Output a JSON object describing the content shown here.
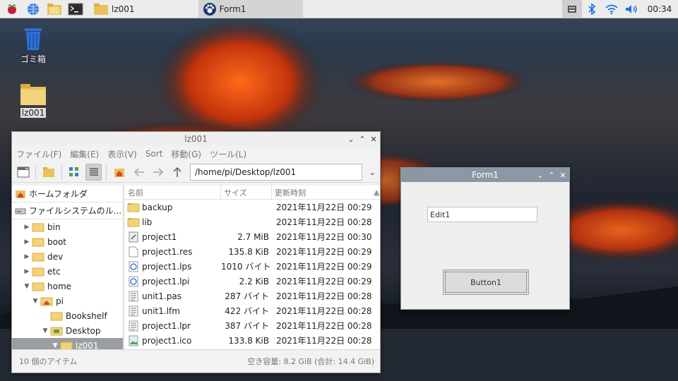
{
  "taskbar": {
    "tasks": [
      {
        "label": "lz001"
      },
      {
        "label": "Form1"
      }
    ],
    "clock": "00:34"
  },
  "desktop": {
    "icons": [
      {
        "label": "ゴミ箱"
      },
      {
        "label": "lz001"
      }
    ]
  },
  "file_manager": {
    "title": "lz001",
    "menu": [
      "ファイル(F)",
      "編集(E)",
      "表示(V)",
      "Sort",
      "移動(G)",
      "ツール(L)"
    ],
    "path": "/home/pi/Desktop/lz001",
    "sidebar": {
      "places": [
        "ホームフォルダ",
        "ファイルシステムのル..."
      ],
      "tree": [
        "bin",
        "boot",
        "dev",
        "etc",
        "home",
        "pi",
        "Bookshelf",
        "Desktop",
        "lz001"
      ]
    },
    "columns": {
      "name": "名前",
      "size": "サイズ",
      "modified": "更新時刻"
    },
    "files": [
      {
        "name": "backup",
        "size": "",
        "modified": "2021年11月22日 00:29",
        "icon": "folder"
      },
      {
        "name": "lib",
        "size": "",
        "modified": "2021年11月22日 00:28",
        "icon": "folder"
      },
      {
        "name": "project1",
        "size": "2.7 MiB",
        "modified": "2021年11月22日 00:30",
        "icon": "executable"
      },
      {
        "name": "project1.res",
        "size": "135.8 KiB",
        "modified": "2021年11月22日 00:29",
        "icon": "file"
      },
      {
        "name": "project1.lps",
        "size": "1010 バイト",
        "modified": "2021年11月22日 00:29",
        "icon": "xml"
      },
      {
        "name": "project1.lpi",
        "size": "2.2 KiB",
        "modified": "2021年11月22日 00:29",
        "icon": "xml"
      },
      {
        "name": "unit1.pas",
        "size": "287 バイト",
        "modified": "2021年11月22日 00:28",
        "icon": "text"
      },
      {
        "name": "unit1.lfm",
        "size": "422 バイト",
        "modified": "2021年11月22日 00:28",
        "icon": "text"
      },
      {
        "name": "project1.lpr",
        "size": "387 バイト",
        "modified": "2021年11月22日 00:28",
        "icon": "text"
      },
      {
        "name": "project1.ico",
        "size": "133.8 KiB",
        "modified": "2021年11月22日 00:28",
        "icon": "image"
      }
    ],
    "status_left": "10 個のアイテム",
    "status_right": "空き容量: 8.2 GiB (合計: 14.4 GiB)"
  },
  "form1": {
    "title": "Form1",
    "edit_value": "Edit1",
    "button_label": "Button1"
  }
}
